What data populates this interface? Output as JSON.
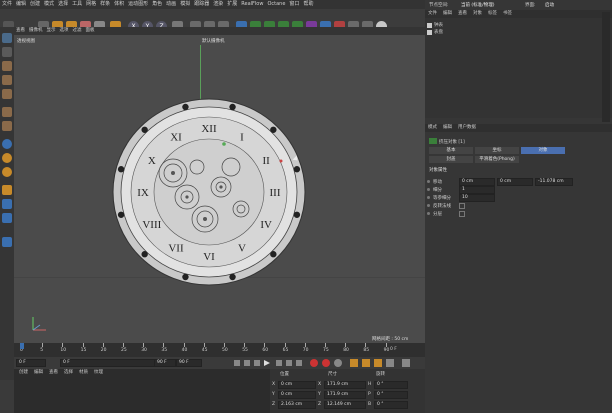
{
  "menu": [
    "文件",
    "编辑",
    "创建",
    "模式",
    "选择",
    "工具",
    "网格",
    "样条",
    "体积",
    "运动图形",
    "角色",
    "动画",
    "模拟",
    "跟踪器",
    "渲染",
    "扩展",
    "RealFlow",
    "Octane",
    "窗口",
    "帮助"
  ],
  "layout": {
    "label": "界面:",
    "value": "启动"
  },
  "node_space": {
    "label": "节点空间:",
    "value": "当前 (标准/物理)"
  },
  "xyz": [
    "X",
    "Y",
    "Z"
  ],
  "viewport_menu": [
    "查看",
    "摄像机",
    "显示",
    "选项",
    "过滤",
    "面板"
  ],
  "viewport": {
    "view_name": "透视视图",
    "camera_name": "默认摄像机",
    "grid_spacing": "网格间距 : 50 cm",
    "accent": "#55aa55"
  },
  "timeline": {
    "ticks": [
      "0",
      "5",
      "10",
      "15",
      "20",
      "25",
      "30",
      "35",
      "40",
      "45",
      "50",
      "55",
      "60",
      "65",
      "70",
      "75",
      "80",
      "85",
      "90"
    ],
    "end_frame": "0 F"
  },
  "playback": {
    "start": "0 F",
    "current": "0 F",
    "end_a": "90 F",
    "end_b": "90 F"
  },
  "materials_menu": [
    "创建",
    "编辑",
    "查看",
    "选择",
    "材质",
    "纹理"
  ],
  "coord": {
    "headers": [
      "位置",
      "尺寸",
      "旋转"
    ],
    "rows": [
      {
        "axis": "X",
        "pos": "0 cm",
        "size": "171.9 cm",
        "rot_label": "H",
        "rot": "0 °"
      },
      {
        "axis": "Y",
        "pos": "0 cm",
        "size": "171.9 cm",
        "rot_label": "P",
        "rot": "0 °"
      },
      {
        "axis": "Z",
        "pos": "2.163 cm",
        "size": "12.149 cm",
        "rot_label": "B",
        "rot": "0 °"
      }
    ]
  },
  "objects_panel": {
    "tabs": [
      "文件",
      "编辑",
      "查看",
      "对象",
      "标签",
      "书签"
    ],
    "items": [
      {
        "name": "钟表"
      },
      {
        "name": "表盘"
      }
    ]
  },
  "attributes": {
    "tabs": [
      "模式",
      "编辑",
      "用户数据"
    ],
    "object_title": "挤压对象 [1]",
    "subtabs": [
      "基本",
      "坐标",
      "对象"
    ],
    "subtabs2": [
      "封盖",
      "平滑着色(Phong)"
    ],
    "section": "对象属性",
    "props": [
      {
        "label": "移动",
        "v1": "0 cm",
        "v2": "0 cm",
        "v3": "-11.078 cm"
      },
      {
        "label": "细分",
        "v1": "1"
      },
      {
        "label": "等参细分",
        "v1": "10"
      },
      {
        "label": "反转法线",
        "v1": ""
      },
      {
        "label": "分层",
        "v1": ""
      }
    ]
  },
  "clock": {
    "numerals": [
      "XII",
      "I",
      "II",
      "III",
      "IV",
      "V",
      "VI",
      "VII",
      "VIII",
      "IX",
      "X",
      "XI"
    ]
  }
}
